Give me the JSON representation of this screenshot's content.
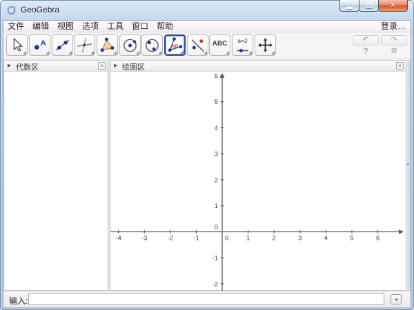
{
  "window": {
    "title": "GeoGebra"
  },
  "menubar": {
    "items": [
      "文件",
      "编辑",
      "视图",
      "选项",
      "工具",
      "窗口",
      "帮助"
    ],
    "login": "登录…"
  },
  "toolbar": {
    "selected_tool": "angle",
    "tools": [
      {
        "name": "move",
        "icon": "cursor-arrow-icon"
      },
      {
        "name": "point-with-label",
        "icon": "point-icon"
      },
      {
        "name": "line-through-two-points",
        "icon": "line-icon"
      },
      {
        "name": "perpendicular-line",
        "icon": "perpendicular-line-icon"
      },
      {
        "name": "polygon",
        "icon": "polygon-icon"
      },
      {
        "name": "circle-with-center",
        "icon": "circle-icon"
      },
      {
        "name": "conic-through-points",
        "icon": "conic-icon"
      },
      {
        "name": "angle",
        "icon": "angle-icon",
        "selected": true
      },
      {
        "name": "reflect-about-line",
        "icon": "reflect-icon"
      },
      {
        "name": "text",
        "icon": "text-icon",
        "glyph": "ABC"
      },
      {
        "name": "slider",
        "icon": "slider-icon",
        "glyph": "a=2"
      },
      {
        "name": "move-graphics-view",
        "icon": "move-graphics-icon"
      }
    ]
  },
  "panels": {
    "algebra": {
      "title": "代数区"
    },
    "graphics": {
      "title": "绘图区"
    }
  },
  "input_bar": {
    "label": "输入:",
    "value": ""
  },
  "icons": {
    "undo": "↶",
    "redo": "↷",
    "help": "?",
    "settings": "⚙",
    "expander": "▶",
    "panel_close": "×",
    "side_collapse": "◂",
    "input_help": "◂",
    "close_window": "✕"
  },
  "chart_data": {
    "type": "axes",
    "title": "",
    "xlabel": "",
    "ylabel": "",
    "x_ticks": [
      -4,
      -3,
      -2,
      -1,
      0,
      1,
      2,
      3,
      4,
      5,
      6
    ],
    "y_ticks": [
      -2,
      -1,
      0,
      1,
      2,
      3,
      4,
      5,
      6
    ],
    "x_range": [
      -4.35,
      7.05
    ],
    "y_range": [
      -2.45,
      6.3
    ],
    "grid": false,
    "points": [],
    "objects": []
  }
}
